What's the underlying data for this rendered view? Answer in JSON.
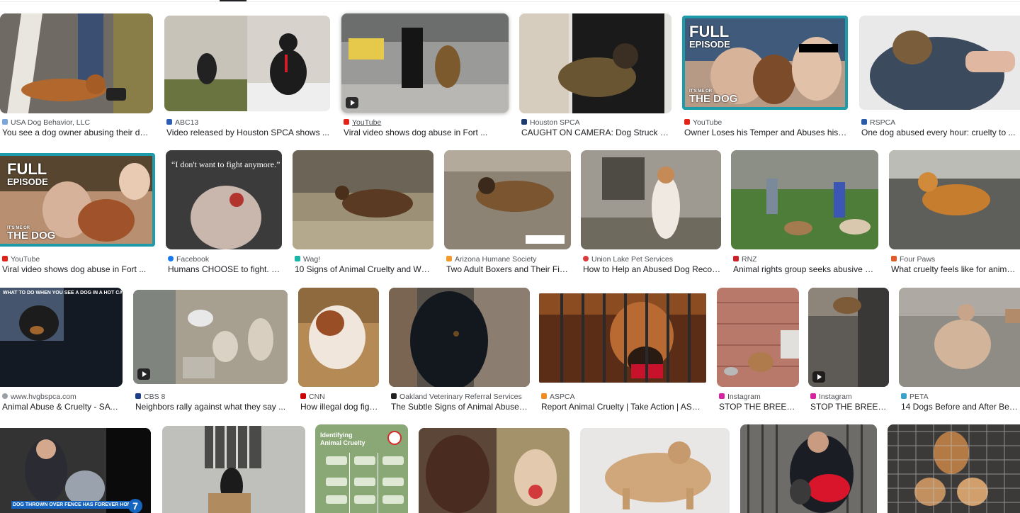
{
  "rows": [
    [
      {
        "source": "USA Dog Behavior, LLC",
        "title": "You see a dog owner abusing their dog ...",
        "fav": "#7aa7d8",
        "video": false
      },
      {
        "source": "ABC13",
        "title": "Video released by Houston SPCA shows ...",
        "fav": "#2b5fb6",
        "video": false
      },
      {
        "source": "YouTube",
        "title": "Viral video shows dog abuse in Fort ...",
        "fav": "#e62117",
        "video": true
      },
      {
        "source": "Houston SPCA",
        "title": "CAUGHT ON CAMERA: Dog Struck with ...",
        "fav": "#1c3b6f",
        "video": false
      },
      {
        "source": "YouTube",
        "title": "Owner Loses his Temper and Abuses his ...",
        "fav": "#e62117",
        "video": false,
        "overlay": {
          "line1": "FULL",
          "line2": "EPISODE",
          "brand_small": "IT'S ME OR",
          "brand_big": "THE DOG"
        }
      },
      {
        "source": "RSPCA",
        "title": "One dog abused every hour: cruelty to ...",
        "fav": "#2a5aa8",
        "video": false
      }
    ],
    [
      {
        "source": "YouTube",
        "title": "Viral video shows dog abuse in Fort ...",
        "fav": "#e62117",
        "video": false,
        "overlay": {
          "line1": "FULL",
          "line2": "EPISODE",
          "brand_small": "IT'S ME OR",
          "brand_big": "THE DOG"
        }
      },
      {
        "source": "Facebook",
        "title": "Humans CHOOSE to fight. Lo...",
        "fav": "#1877f2",
        "video": false,
        "quote": "“I don't want to fight anymore.”"
      },
      {
        "source": "Wag!",
        "title": "10 Signs of Animal Cruelty and What...",
        "fav": "#19b5a8",
        "video": false
      },
      {
        "source": "Arizona Humane Society",
        "title": "Two Adult Boxers and Their Five ...",
        "fav": "#f39a2e",
        "video": false
      },
      {
        "source": "Union Lake Pet Services",
        "title": "How to Help an Abused Dog Recove...",
        "fav": "#d93a3a",
        "video": false
      },
      {
        "source": "RNZ",
        "title": "Animal rights group seeks abusive dog...",
        "fav": "#d0202a",
        "video": false
      },
      {
        "source": "Four Paws",
        "title": "What cruelty feels like for animals ...",
        "fav": "#e05a2b",
        "video": false
      }
    ],
    [
      {
        "source": "www.hvgbspca.com",
        "title": "Animal Abuse & Cruelty - SAVIN...",
        "fav": "#9aa0a6",
        "video": false,
        "infographic": "WHAT TO DO WHEN YOU SEE A DOG IN A HOT CAR:"
      },
      {
        "source": "CBS 8",
        "title": "Neighbors rally against what they say ...",
        "fav": "#1a3e8c",
        "video": true
      },
      {
        "source": "CNN",
        "title": "How illegal dog figh...",
        "fav": "#cc0000",
        "video": false
      },
      {
        "source": "Oakland Veterinary Referral Services",
        "title": "The Subtle Signs of Animal Abuse in ...",
        "fav": "#222222",
        "video": false
      },
      {
        "source": "ASPCA",
        "title": "Report Animal Cruelty | Take Action | ASPCA",
        "fav": "#f28b20",
        "video": false
      },
      {
        "source": "Instagram",
        "title": "STOP THE BREEDIN...",
        "fav": "#d6249f",
        "video": false
      },
      {
        "source": "Instagram",
        "title": "STOP THE BREEDIN...",
        "fav": "#d6249f",
        "video": true
      },
      {
        "source": "PETA",
        "title": "14 Dogs Before and After Being ...",
        "fav": "#3aa1c9",
        "video": false
      }
    ],
    [
      {
        "banner": "DOG THROWN OVER FENCE HAS FOREVER HOME",
        "channel": "7"
      },
      {},
      {
        "poster_title": "Identifying\nAnimal Cruelty"
      },
      {},
      {},
      {},
      {}
    ]
  ]
}
